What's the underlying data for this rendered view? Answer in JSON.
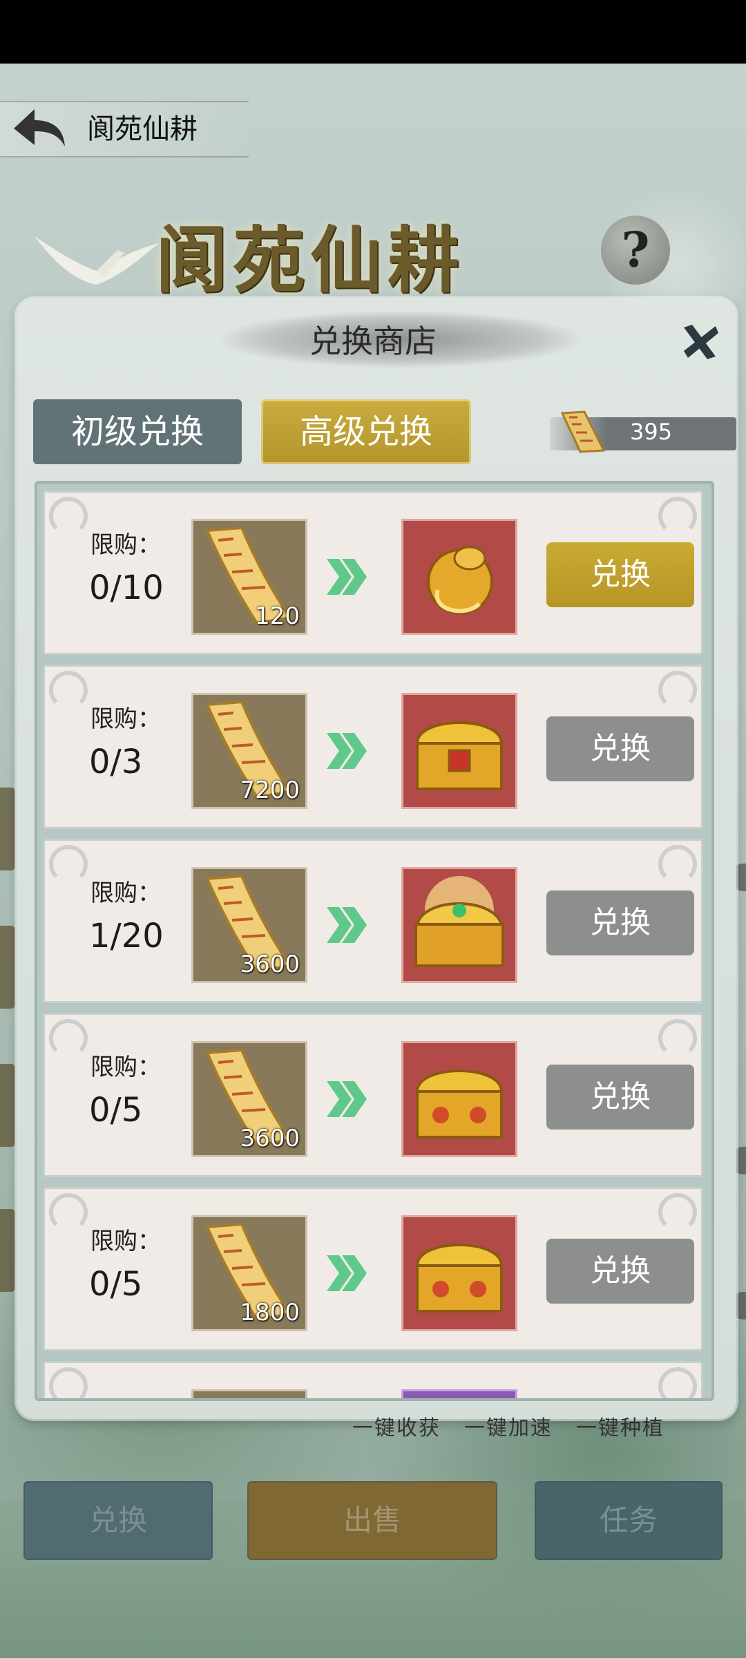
{
  "header": {
    "back_label": "",
    "title": "阆苑仙耕",
    "banner_title": "阆苑仙耕",
    "help_glyph": "?"
  },
  "modal": {
    "title": "兑换商店",
    "tabs": [
      {
        "label": "初级兑换",
        "selected": false
      },
      {
        "label": "高级兑换",
        "selected": true
      }
    ],
    "currency": {
      "icon": "scroll-icon",
      "value": "395"
    },
    "limit_label": "限购：",
    "items": [
      {
        "limit": "0/10",
        "cost_icon": "scroll-icon",
        "cost": "120",
        "reward_icon": "golden-ferret-icon",
        "button": "兑换",
        "active": true
      },
      {
        "limit": "0/3",
        "cost_icon": "scroll-icon",
        "cost": "7200",
        "reward_icon": "gold-chest-icon",
        "button": "兑换",
        "active": false
      },
      {
        "limit": "1/20",
        "cost_icon": "scroll-icon",
        "cost": "3600",
        "reward_icon": "treasure-chest-icon",
        "button": "兑换",
        "active": false
      },
      {
        "limit": "0/5",
        "cost_icon": "scroll-icon",
        "cost": "3600",
        "reward_icon": "gold-chest-icon",
        "button": "兑换",
        "active": false
      },
      {
        "limit": "0/5",
        "cost_icon": "scroll-icon",
        "cost": "1800",
        "reward_icon": "gold-chest-icon",
        "button": "兑换",
        "active": false
      }
    ]
  },
  "actions": {
    "harvest": "一键收获",
    "speedup": "一键加速",
    "plant": "一键种植"
  },
  "bottom": {
    "exchange": "兑换",
    "sell": "出售",
    "task": "任务"
  },
  "colors": {
    "gold": "#c9ab33",
    "slate": "#617376",
    "reward_red": "#b24b48",
    "gray_button": "#8d8f8e"
  }
}
